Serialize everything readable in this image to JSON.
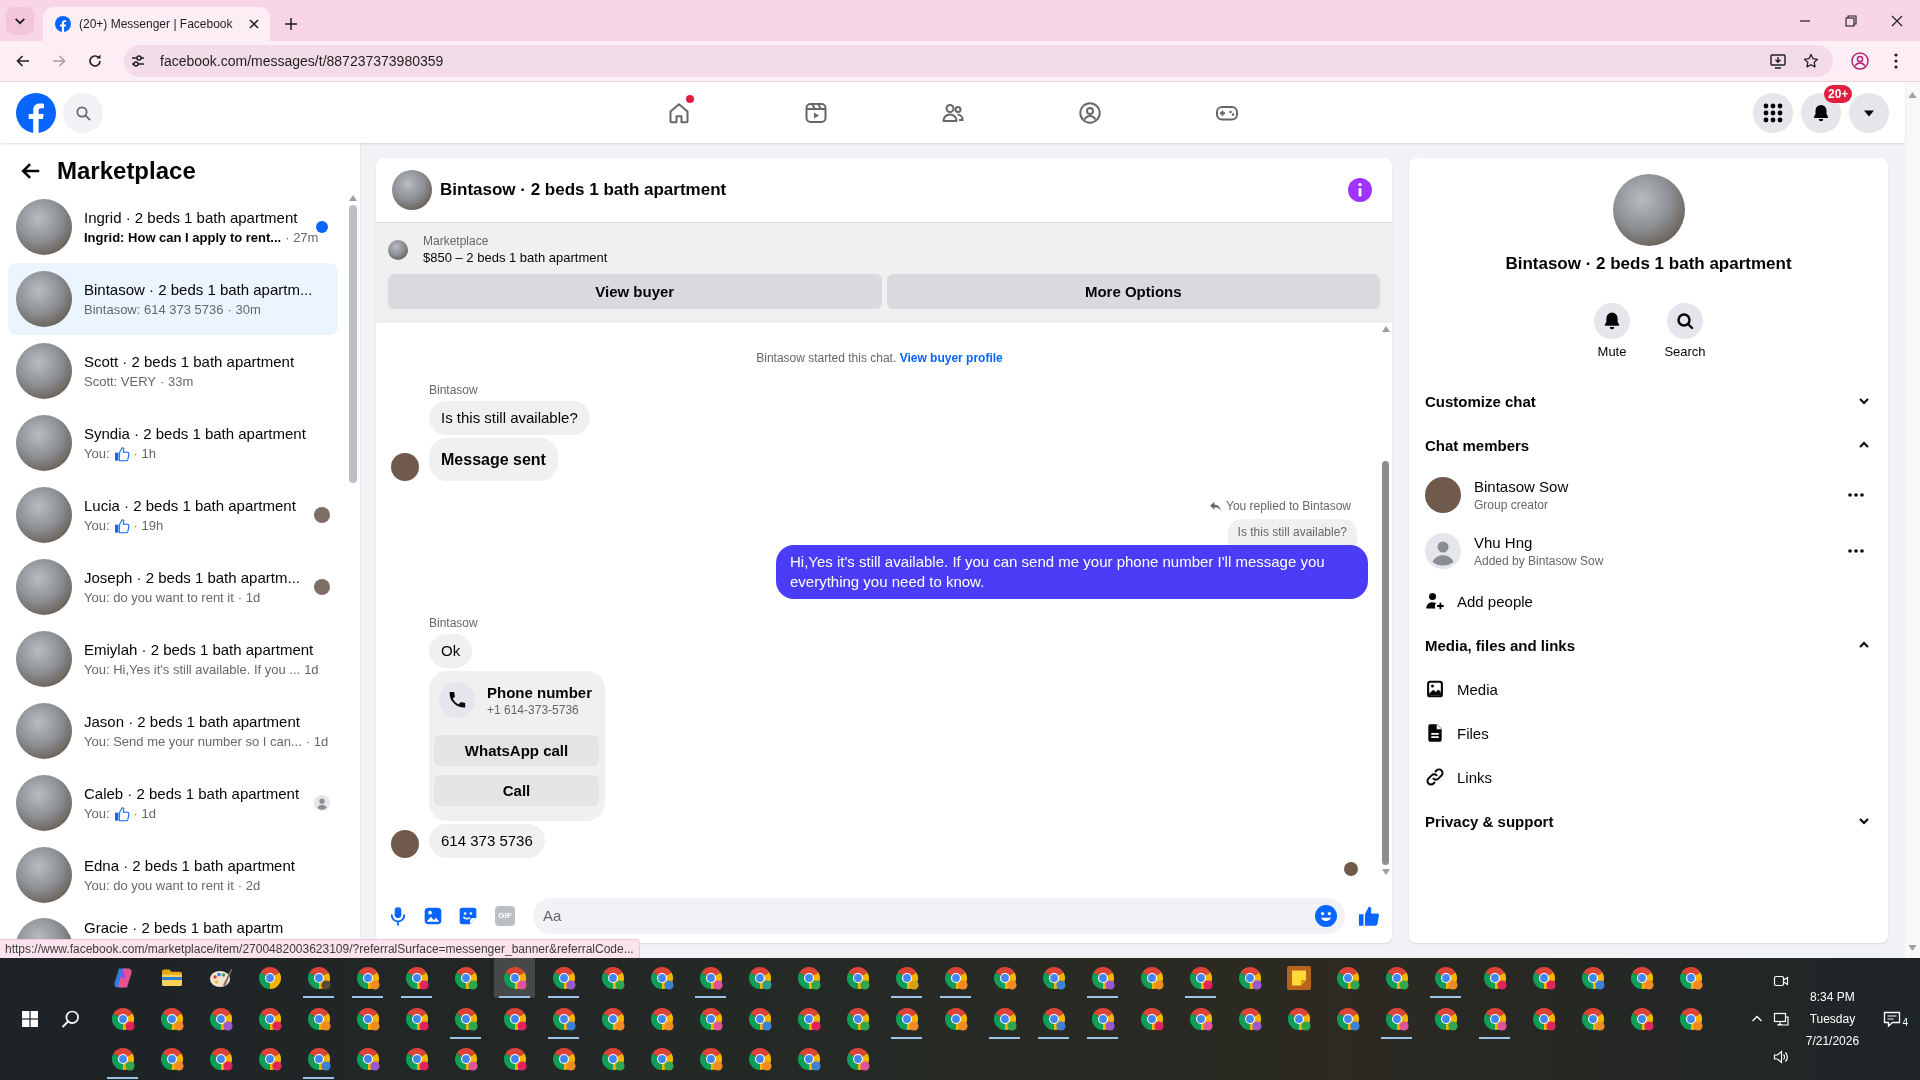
{
  "browser": {
    "tab_title": "(20+) Messenger | Facebook",
    "nav_buttons": [
      {
        "kind": "back",
        "disabled": false
      },
      {
        "kind": "forward",
        "disabled": true
      },
      {
        "kind": "reload",
        "disabled": false
      }
    ],
    "url": "facebook.com/messages/t/887237373980359"
  },
  "header": {
    "nav": [
      {
        "kind": "home",
        "selected": false,
        "dot": true
      },
      {
        "kind": "video",
        "selected": false,
        "dot": false
      },
      {
        "kind": "friends",
        "selected": false,
        "dot": false
      },
      {
        "kind": "groups",
        "selected": false,
        "dot": false
      },
      {
        "kind": "gaming",
        "selected": false,
        "dot": false
      }
    ],
    "notification_badge": "20+"
  },
  "sidebar": {
    "title": "Marketplace",
    "conversations": [
      {
        "name": "Ingrid · 2 beds 1 bath apartment",
        "preview": "Ingrid: How can I apply to rent...",
        "time": "· 27m",
        "unread": true,
        "selected": false,
        "like": false
      },
      {
        "name": "Bintasow · 2 beds 1 bath apartm...",
        "preview": "Bintasow: 614 373 5736",
        "time": "· 30m",
        "unread": false,
        "selected": true,
        "like": false
      },
      {
        "name": "Scott · 2 beds 1 bath apartment",
        "preview": "Scott: VERY",
        "time": "· 33m",
        "unread": false,
        "selected": false,
        "like": false
      },
      {
        "name": "Syndia · 2 beds 1 bath apartment",
        "preview": "You:",
        "time": "· 1h",
        "unread": false,
        "selected": false,
        "like": true
      },
      {
        "name": "Lucia · 2 beds 1 bath apartment",
        "preview": "You:",
        "time": "· 19h",
        "unread": false,
        "selected": false,
        "like": true,
        "receipt": {
          "kind": "photo"
        }
      },
      {
        "name": "Joseph · 2 beds 1 bath apartm...",
        "preview": "You: do you want to rent it",
        "time": "· 1d",
        "unread": false,
        "selected": false,
        "like": false,
        "receipt": {
          "kind": "photo"
        }
      },
      {
        "name": "Emiylah · 2 beds 1 bath apartment",
        "preview": "You: Hi,Yes it's still available. If you ...",
        "time": "1d",
        "unread": false,
        "selected": false,
        "like": false
      },
      {
        "name": "Jason · 2 beds 1 bath apartment",
        "preview": "You: Send me your number so I can...",
        "time": "· 1d",
        "unread": false,
        "selected": false,
        "like": false
      },
      {
        "name": "Caleb · 2 beds 1 bath apartment",
        "preview": "You:",
        "time": "· 1d",
        "unread": false,
        "selected": false,
        "like": true,
        "receipt": {
          "kind": "generic"
        }
      },
      {
        "name": "Edna · 2 beds 1 bath apartment",
        "preview": "You: do you want to rent it",
        "time": "· 2d",
        "unread": false,
        "selected": false,
        "like": false
      },
      {
        "name": "Gracie · 2 beds 1 bath apartm",
        "unread": false,
        "selected": false,
        "like": false
      }
    ]
  },
  "chat": {
    "title": "Bintasow · 2 beds 1 bath apartment",
    "banner": {
      "label": "Marketplace",
      "listing": "$850 – 2 beds 1 bath apartment",
      "buttons": [
        "View buyer",
        "More Options"
      ]
    },
    "messages": [
      {
        "kind": "system",
        "text": "Bintasow started this chat.",
        "link": "View buyer profile"
      },
      {
        "kind": "sender",
        "text": "Bintasow"
      },
      {
        "kind": "incoming",
        "text": "Is this still available?",
        "avatar": false,
        "bold": false
      },
      {
        "kind": "incoming",
        "text": "Message sent",
        "avatar": true,
        "bold": true
      },
      {
        "kind": "reply_note",
        "text": "You replied to Bintasow"
      },
      {
        "kind": "quote",
        "text": "Is this still available?"
      },
      {
        "kind": "outgoing",
        "text": "Hi,Yes it's still available. If you can send me your phone number I'll message you everything you need to know."
      },
      {
        "kind": "sender",
        "text": "Bintasow"
      },
      {
        "kind": "incoming",
        "text": "Ok",
        "avatar": false,
        "bold": false
      },
      {
        "kind": "contact",
        "title": "Phone number",
        "number": "+1 614-373-5736",
        "buttons": [
          "WhatsApp call",
          "Call"
        ]
      },
      {
        "kind": "incoming",
        "text": "614 373 5736",
        "avatar": true,
        "bold": false
      },
      {
        "kind": "seen"
      }
    ],
    "composer": {
      "gif_label": "GIF",
      "placeholder": "Aa"
    }
  },
  "details": {
    "title": "Bintasow · 2 beds 1 bath apartment",
    "actions": [
      {
        "kind": "mute",
        "label": "Mute"
      },
      {
        "kind": "search",
        "label": "Search"
      }
    ],
    "sections": [
      {
        "title": "Customize chat",
        "expanded": false
      },
      {
        "title": "Chat members",
        "expanded": true,
        "members": [
          {
            "kind": "photo",
            "name": "Bintasow Sow",
            "role": "Group creator"
          },
          {
            "kind": "generic",
            "name": "Vhu Hng",
            "role": "Added by Bintasow Sow"
          }
        ],
        "items": [
          {
            "kind": "add_people",
            "label": "Add people"
          }
        ]
      },
      {
        "title": "Media, files and links",
        "expanded": true,
        "items": [
          {
            "kind": "media",
            "label": "Media"
          },
          {
            "kind": "files",
            "label": "Files"
          },
          {
            "kind": "links",
            "label": "Links"
          }
        ]
      },
      {
        "title": "Privacy & support",
        "expanded": false
      }
    ]
  },
  "status_url": "https://www.facebook.com/marketplace/item/2700482003623109/?referralSurface=messenger_banner&referralCode...",
  "taskbar": {
    "rows": [
      [
        {
          "kind": "copilot",
          "running": false,
          "active": false
        },
        {
          "kind": "folder",
          "running": false,
          "active": false
        },
        {
          "kind": "paint",
          "running": false,
          "active": false
        },
        {
          "kind": "chrome",
          "running": false,
          "active": false
        },
        {
          "kind": "chrome",
          "color": "#5a4a3a",
          "running": true,
          "active": false
        },
        {
          "kind": "chrome",
          "color": "#f08a24",
          "running": true,
          "active": false
        },
        {
          "kind": "chrome",
          "color": "#e0245e",
          "running": true,
          "active": false
        },
        {
          "kind": "chrome",
          "color": "#2fa84f",
          "running": false,
          "active": false
        },
        {
          "kind": "chrome",
          "color": "#e0559a",
          "running": true,
          "active": true
        },
        {
          "kind": "chrome",
          "color": "#9b59d0",
          "running": true,
          "active": false
        },
        {
          "kind": "chrome",
          "color": "#2fa84f",
          "running": false,
          "active": false
        },
        {
          "kind": "chrome",
          "color": "#3b82d6",
          "running": false,
          "active": false
        },
        {
          "kind": "chrome",
          "color": "#e0559a",
          "running": true,
          "active": false
        },
        {
          "kind": "chrome",
          "color": "#2a9d8f",
          "running": false,
          "active": false
        },
        {
          "kind": "chrome",
          "color": "#2fa84f",
          "running": false,
          "active": false
        },
        {
          "kind": "chrome",
          "color": "#2fa84f",
          "running": false,
          "active": false
        },
        {
          "kind": "chrome",
          "color": "#d4a017",
          "running": true,
          "active": false
        },
        {
          "kind": "chrome",
          "color": "#f08a24",
          "running": true,
          "active": false
        },
        {
          "kind": "chrome",
          "color": "#f08a24",
          "running": false,
          "active": false
        },
        {
          "kind": "chrome",
          "color": "#3b82d6",
          "running": false,
          "active": false
        },
        {
          "kind": "chrome",
          "color": "#9b59d0",
          "running": true,
          "active": false
        },
        {
          "kind": "chrome",
          "color": "#f08a24",
          "running": false,
          "active": false
        },
        {
          "kind": "chrome",
          "color": "#e0245e",
          "running": true,
          "active": false
        },
        {
          "kind": "chrome",
          "color": "#9b59d0",
          "running": false,
          "active": false
        },
        {
          "kind": "sticky",
          "running": false,
          "active": false
        },
        {
          "kind": "chrome",
          "color": "#2fa84f",
          "running": false,
          "active": false
        },
        {
          "kind": "chrome",
          "color": "#2fa84f",
          "running": false,
          "active": false
        },
        {
          "kind": "chrome",
          "color": "#f08a24",
          "running": true,
          "active": false
        },
        {
          "kind": "chrome",
          "color": "#e0245e",
          "running": false,
          "active": false
        },
        {
          "kind": "chrome",
          "color": "#e0245e",
          "running": false,
          "active": false
        },
        {
          "kind": "chrome",
          "color": "#3b82d6",
          "running": false,
          "active": false
        },
        {
          "kind": "chrome",
          "color": "#f08a24",
          "running": false,
          "active": false
        },
        {
          "kind": "chrome",
          "color": "#f08a24",
          "running": false,
          "active": false
        }
      ],
      [
        {
          "kind": "chrome",
          "color": "#e0245e",
          "running": false,
          "active": false
        },
        {
          "kind": "chrome",
          "color": "#f08a24",
          "running": false,
          "active": false
        },
        {
          "kind": "chrome",
          "color": "#9b59d0",
          "running": false,
          "active": false
        },
        {
          "kind": "chrome",
          "color": "#e0245e",
          "running": false,
          "active": false
        },
        {
          "kind": "chrome",
          "color": "#f08a24",
          "running": false,
          "active": false
        },
        {
          "kind": "chrome",
          "color": "#f08a24",
          "running": false,
          "active": false
        },
        {
          "kind": "chrome",
          "color": "#e0245e",
          "running": false,
          "active": false
        },
        {
          "kind": "chrome",
          "color": "#2fa84f",
          "running": true,
          "active": false
        },
        {
          "kind": "chrome",
          "color": "#e0245e",
          "running": false,
          "active": false
        },
        {
          "kind": "chrome",
          "color": "#3b82d6",
          "running": true,
          "active": false
        },
        {
          "kind": "chrome",
          "color": "#f08a24",
          "running": false,
          "active": false
        },
        {
          "kind": "chrome",
          "color": "#f08a24",
          "running": false,
          "active": false
        },
        {
          "kind": "chrome",
          "color": "#e0559a",
          "running": false,
          "active": false
        },
        {
          "kind": "chrome",
          "color": "#3b82d6",
          "running": false,
          "active": false
        },
        {
          "kind": "chrome",
          "color": "#e0245e",
          "running": false,
          "active": false
        },
        {
          "kind": "chrome",
          "color": "#2fa84f",
          "running": false,
          "active": false
        },
        {
          "kind": "chrome",
          "color": "#f08a24",
          "running": true,
          "active": false
        },
        {
          "kind": "chrome",
          "color": "#f08a24",
          "running": false,
          "active": false
        },
        {
          "kind": "chrome",
          "color": "#2fa84f",
          "running": true,
          "active": false
        },
        {
          "kind": "chrome",
          "color": "#3b82d6",
          "running": true,
          "active": false
        },
        {
          "kind": "chrome",
          "color": "#9b59d0",
          "running": true,
          "active": false
        },
        {
          "kind": "chrome",
          "color": "#e0245e",
          "running": false,
          "active": false
        },
        {
          "kind": "chrome",
          "color": "#e0559a",
          "running": false,
          "active": false
        },
        {
          "kind": "chrome",
          "color": "#9b59d0",
          "running": false,
          "active": false
        },
        {
          "kind": "chrome",
          "color": "#2fa84f",
          "running": false,
          "active": false
        },
        {
          "kind": "chrome",
          "color": "#3b82d6",
          "running": false,
          "active": false
        },
        {
          "kind": "chrome",
          "color": "#e0559a",
          "running": true,
          "active": false
        },
        {
          "kind": "chrome",
          "color": "#2fa84f",
          "running": false,
          "active": false
        },
        {
          "kind": "chrome",
          "color": "#e0559a",
          "running": true,
          "active": false
        },
        {
          "kind": "chrome",
          "color": "#e0245e",
          "running": false,
          "active": false
        },
        {
          "kind": "chrome",
          "color": "#f08a24",
          "running": false,
          "active": false
        },
        {
          "kind": "chrome",
          "color": "#e0245e",
          "running": false,
          "active": false
        },
        {
          "kind": "chrome",
          "color": "#f08a24",
          "running": false,
          "active": false
        }
      ],
      [
        {
          "kind": "chrome",
          "color": "#2fa84f",
          "running": true,
          "active": false
        },
        {
          "kind": "chrome",
          "color": "#f08a24",
          "running": false,
          "active": false
        },
        {
          "kind": "chrome",
          "color": "#e0245e",
          "running": false,
          "active": false
        },
        {
          "kind": "chrome",
          "color": "#e0245e",
          "running": false,
          "active": false
        },
        {
          "kind": "chrome",
          "color": "#3b82d6",
          "running": true,
          "active": false
        },
        {
          "kind": "chrome",
          "color": "#9b59d0",
          "running": false,
          "active": false
        },
        {
          "kind": "chrome",
          "color": "#e0245e",
          "running": false,
          "active": false
        },
        {
          "kind": "chrome",
          "color": "#e0559a",
          "running": false,
          "active": false
        },
        {
          "kind": "chrome",
          "color": "#e0245e",
          "running": false,
          "active": false
        },
        {
          "kind": "chrome",
          "color": "#f08a24",
          "running": false,
          "active": false
        },
        {
          "kind": "chrome",
          "color": "#2fa84f",
          "running": false,
          "active": false
        },
        {
          "kind": "chrome",
          "color": "#2fa84f",
          "running": false,
          "active": false
        },
        {
          "kind": "chrome",
          "color": "#f08a24",
          "running": false,
          "active": false
        },
        {
          "kind": "chrome",
          "color": "#f08a24",
          "running": false,
          "active": false
        },
        {
          "kind": "chrome",
          "color": "#3b82d6",
          "running": false,
          "active": false
        },
        {
          "kind": "chrome",
          "color": "#e0559a",
          "running": false,
          "active": false
        }
      ]
    ],
    "clock": {
      "time": "8:34 PM",
      "day": "Tuesday",
      "date": "7/21/2026"
    },
    "notification_count": "4"
  }
}
